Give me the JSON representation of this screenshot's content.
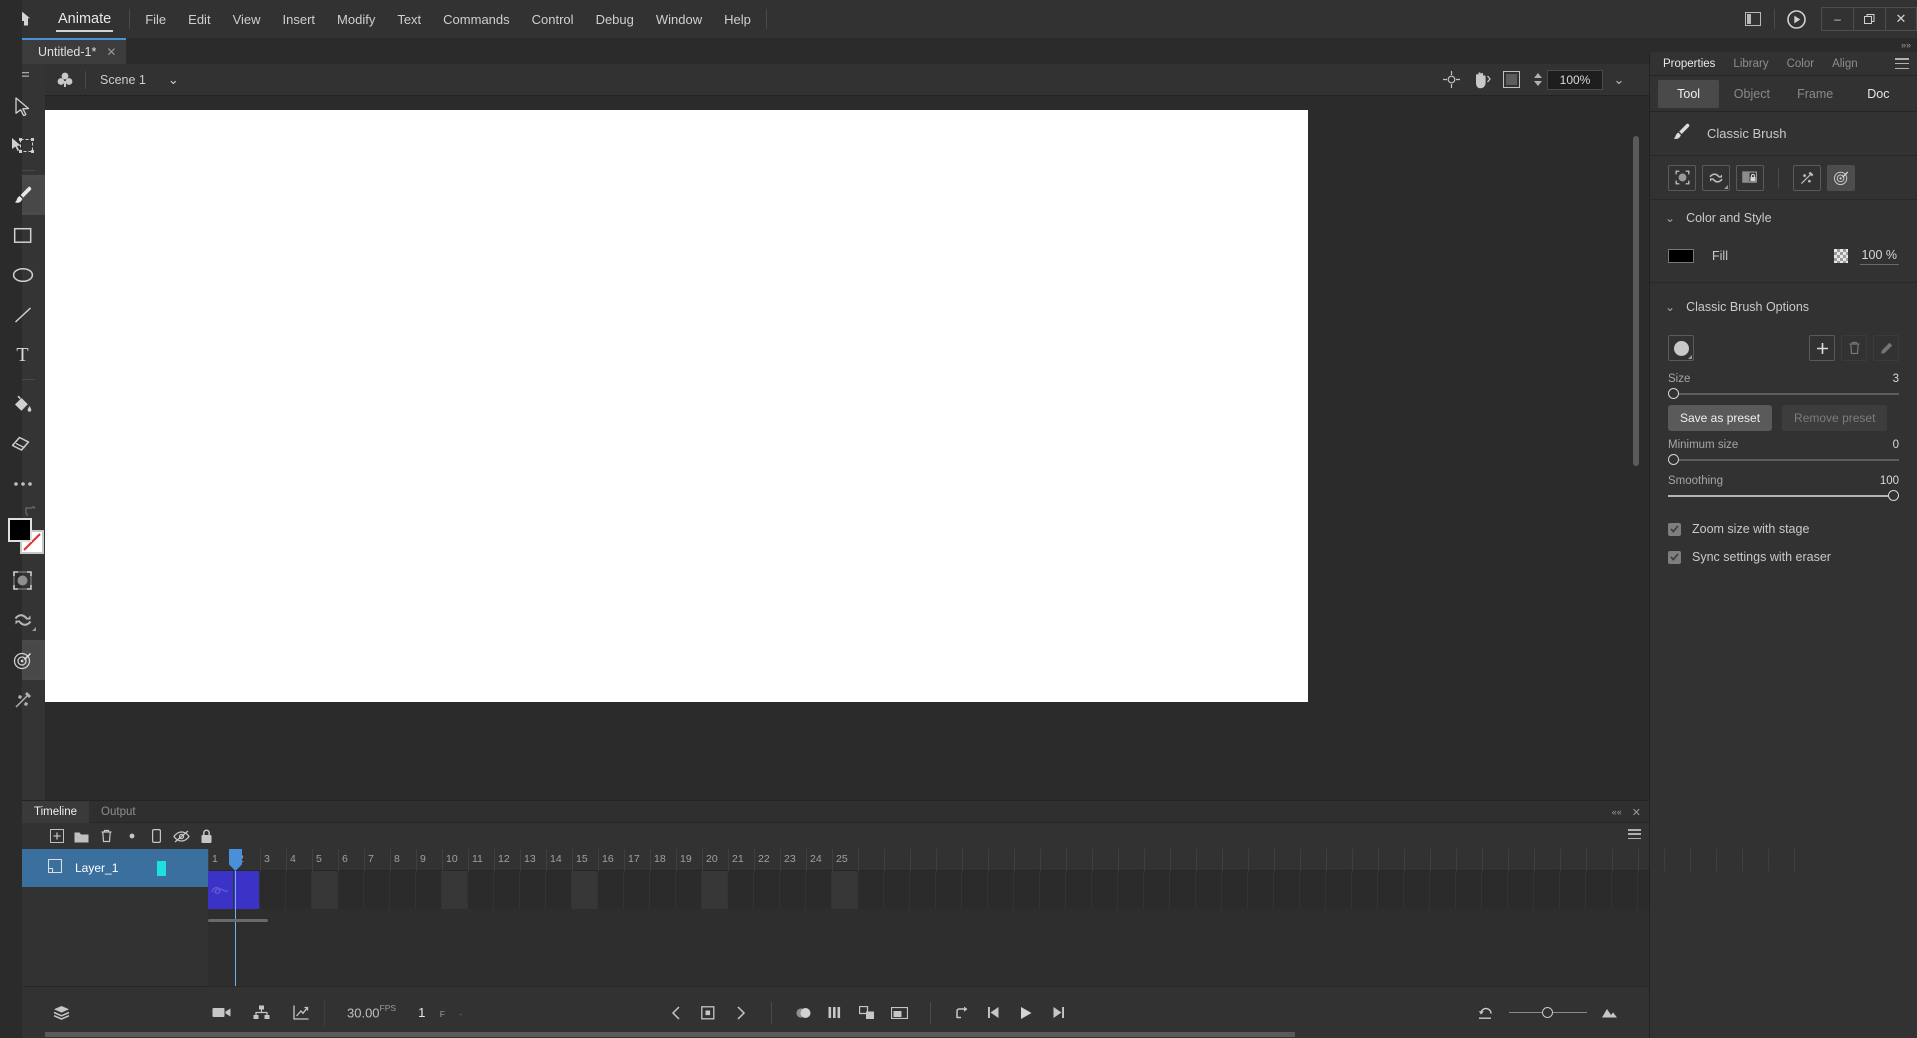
{
  "menubar": {
    "home_icon": "home-icon",
    "app_name": "Animate",
    "items": [
      "File",
      "Edit",
      "View",
      "Insert",
      "Modify",
      "Text",
      "Commands",
      "Control",
      "Debug",
      "Window",
      "Help"
    ],
    "right_icons": [
      "panel-layout-icon",
      "play-preview-icon"
    ],
    "window_controls": {
      "minimize": "–",
      "maximize": "❐",
      "close": "✕"
    }
  },
  "doctab": {
    "title": "Untitled-1*",
    "close": "✕"
  },
  "toolbar": {
    "tools": [
      {
        "name": "selection-tool",
        "label": "Selection"
      },
      {
        "name": "free-transform-tool",
        "label": "Free Transform"
      },
      {
        "name": "brush-tool",
        "label": "Classic Brush",
        "active": true
      },
      {
        "name": "rectangle-tool",
        "label": "Rectangle"
      },
      {
        "name": "oval-tool",
        "label": "Oval"
      },
      {
        "name": "line-tool",
        "label": "Line"
      },
      {
        "name": "text-tool",
        "label": "Text"
      },
      {
        "name": "paint-bucket-tool",
        "label": "Paint Bucket"
      },
      {
        "name": "eraser-tool",
        "label": "Eraser"
      },
      {
        "name": "more-tools",
        "label": "More Tools"
      }
    ],
    "bottom_tools": [
      {
        "name": "object-drawing-toggle",
        "label": "Object Drawing"
      },
      {
        "name": "smooth-mode-toggle",
        "label": "Smooth"
      },
      {
        "name": "paint-target-toggle",
        "label": "Paint Selection",
        "active": true
      },
      {
        "name": "pressure-toggle",
        "label": "Pressure / Tilt"
      }
    ],
    "fill_color": "#000000",
    "stroke_color": "#ffffff"
  },
  "stage": {
    "scene_icon": "scene-club-icon",
    "scene_name": "Scene 1",
    "scene_chevron": "⌄",
    "tools_right": [
      "center-stage-icon",
      "hand-icon",
      "fit-stage-icon"
    ],
    "zoom_value": "100%",
    "zoom_chevron": "⌄"
  },
  "properties": {
    "collapse": "»»",
    "panel_tabs": [
      {
        "label": "Properties",
        "selected": true
      },
      {
        "label": "Library",
        "selected": false
      },
      {
        "label": "Color",
        "selected": false
      },
      {
        "label": "Align",
        "selected": false
      }
    ],
    "segments": [
      {
        "label": "Tool",
        "selected": true
      },
      {
        "label": "Object",
        "selected": false
      },
      {
        "label": "Frame",
        "selected": false
      },
      {
        "label": "Doc",
        "selected": false
      }
    ],
    "tool_name": "Classic Brush",
    "tool_icon": "brush-icon",
    "option_buttons": [
      {
        "name": "object-drawing-option",
        "active": false
      },
      {
        "name": "smoothing-mode-option",
        "active": false
      },
      {
        "name": "paint-inside-option",
        "active": false
      },
      {
        "name": "pressure-option",
        "active": false
      },
      {
        "name": "paint-target-option",
        "active": true
      }
    ],
    "color_and_style": {
      "title": "Color and Style",
      "chevron": "⌄",
      "fill_label": "Fill",
      "fill_color": "#000000",
      "alpha_icon": "transparency-checker-icon",
      "alpha_value": "100 %"
    },
    "classic_brush_options": {
      "title": "Classic Brush Options",
      "chevron": "⌄",
      "preset_preview": "brush-shape-preview",
      "actions": [
        {
          "name": "add-preset-button",
          "glyph": "+",
          "disabled": false
        },
        {
          "name": "delete-preset-button",
          "glyph": "trash-icon",
          "disabled": true
        },
        {
          "name": "edit-preset-button",
          "glyph": "pencil-icon",
          "disabled": true
        }
      ],
      "size": {
        "label": "Size",
        "value": "3",
        "fraction": 0.02
      },
      "save_preset_label": "Save as preset",
      "remove_preset_label": "Remove preset",
      "minimum_size": {
        "label": "Minimum size",
        "value": "0",
        "fraction": 0.0
      },
      "smoothing": {
        "label": "Smoothing",
        "value": "100",
        "fraction": 1.0
      },
      "checkboxes": [
        {
          "label": "Zoom size with stage",
          "checked": true
        },
        {
          "label": "Sync settings with eraser",
          "checked": true
        }
      ]
    }
  },
  "timeline": {
    "tabs": [
      {
        "label": "Timeline",
        "selected": true
      },
      {
        "label": "Output",
        "selected": false
      }
    ],
    "collapse_icon": "««",
    "close_icon": "✕",
    "toolbar_buttons": [
      {
        "name": "new-layer-button"
      },
      {
        "name": "new-folder-button"
      },
      {
        "name": "delete-layer-button"
      },
      {
        "name": "keyframe-dot-button"
      },
      {
        "name": "outline-layer-button"
      },
      {
        "name": "hide-layers-button"
      },
      {
        "name": "lock-layers-button"
      }
    ],
    "layers": [
      {
        "name": "Layer_1",
        "icon": "layer-icon",
        "selected": true,
        "key_color": "#1ee0e0"
      }
    ],
    "ruler_labels": [
      1,
      2,
      3,
      4,
      5,
      6,
      7,
      8,
      9,
      10,
      11,
      12,
      13,
      14,
      15,
      16,
      17,
      18,
      19,
      20,
      21,
      22,
      23,
      24,
      25
    ],
    "shaded_frames": [
      5,
      10,
      15,
      20,
      25
    ],
    "keyframes": [
      1,
      2
    ],
    "playhead_frame": 1,
    "bottom": {
      "layer_depth_icon": "layer-depth-icon",
      "camera_icon": "camera-icon",
      "parenting-view-icon": "parenting-view-icon",
      "graph_icon": "graph-editor-icon",
      "fps_value": "30.00",
      "fps_unit": "FPS",
      "current_frame": "1",
      "frame_unit": "F",
      "transport": [
        {
          "name": "previous-keyframe-button"
        },
        {
          "name": "insert-keyframe-button"
        },
        {
          "name": "next-keyframe-button"
        },
        {
          "name": "onion-skin-button"
        },
        {
          "name": "onion-skin-outline-button"
        },
        {
          "name": "edit-multiple-frames-button"
        },
        {
          "name": "frame-view-button"
        },
        {
          "name": "loop-button"
        },
        {
          "name": "step-back-button"
        },
        {
          "name": "play-button"
        },
        {
          "name": "step-forward-button"
        }
      ],
      "reset-zoom-icon": "reset-timeline-zoom-icon",
      "resize-icon": "frame-size-icon"
    }
  }
}
